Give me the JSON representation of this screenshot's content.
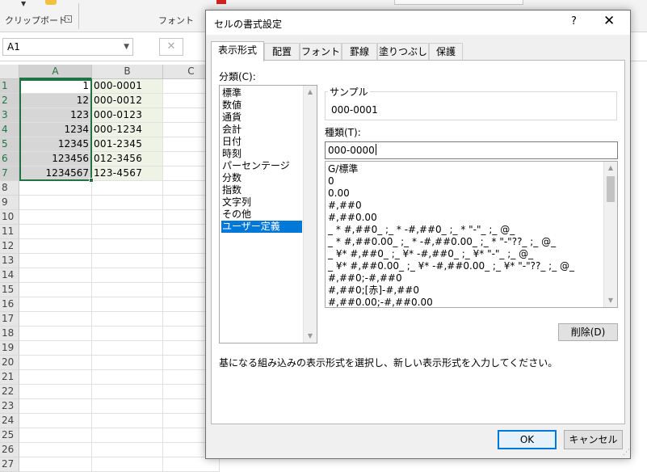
{
  "ribbon": {
    "clipboard_label": "クリップボード",
    "font_label": "フォント",
    "launcher_glyph": "↘"
  },
  "formula_bar": {
    "name_box": "A1",
    "cancel_glyph": "✕"
  },
  "sheet": {
    "columns": [
      "A",
      "B",
      "C"
    ],
    "row_numbers": [
      "1",
      "2",
      "3",
      "4",
      "5",
      "6",
      "7",
      "8",
      "9",
      "10",
      "11",
      "12",
      "13",
      "14",
      "15",
      "16",
      "17",
      "18",
      "19",
      "20",
      "21",
      "22",
      "23",
      "24",
      "25",
      "26",
      "27"
    ],
    "col_a_values": [
      "1",
      "12",
      "123",
      "1234",
      "12345",
      "123456",
      "1234567"
    ],
    "col_b_values": [
      "000-0001",
      "000-0012",
      "000-0123",
      "000-1234",
      "001-2345",
      "012-3456",
      "123-4567"
    ],
    "selection_color": "#217346"
  },
  "dialog": {
    "title": "セルの書式設定",
    "help": "?",
    "close": "✕",
    "tabs": [
      "表示形式",
      "配置",
      "フォント",
      "罫線",
      "塗りつぶし",
      "保護"
    ],
    "active_tab": 0,
    "category_label": "分類(C):",
    "categories": [
      "標準",
      "数値",
      "通貨",
      "会計",
      "日付",
      "時刻",
      "パーセンテージ",
      "分数",
      "指数",
      "文字列",
      "その他",
      "ユーザー定義"
    ],
    "selected_category": 11,
    "sample_label": "サンプル",
    "sample_value": "000-0001",
    "type_label": "種類(T):",
    "type_value": "000-0000",
    "formats": [
      "G/標準",
      "0",
      "0.00",
      "#,##0",
      "#,##0.00",
      "_ * #,##0_ ;_ * -#,##0_ ;_ * \"-\"_ ;_ @_",
      "_ * #,##0.00_ ;_ * -#,##0.00_ ;_ * \"-\"??_ ;_ @_",
      "_ ¥* #,##0_ ;_ ¥* -#,##0_ ;_ ¥* \"-\"_ ;_ @_",
      "_ ¥* #,##0.00_ ;_ ¥* -#,##0.00_ ;_ ¥* \"-\"??_ ;_ @_",
      "#,##0;-#,##0",
      "#,##0;[赤]-#,##0",
      "#,##0.00;-#,##0.00"
    ],
    "delete_button": "削除(D)",
    "description": "基になる組み込みの表示形式を選択し、新しい表示形式を入力してください。",
    "ok_button": "OK",
    "cancel_button": "キャンセル",
    "accent_color": "#0078d7"
  },
  "icons": {
    "scroll_up": "▲",
    "scroll_down": "▼",
    "dropdown": "▼",
    "grip": "⋰"
  }
}
